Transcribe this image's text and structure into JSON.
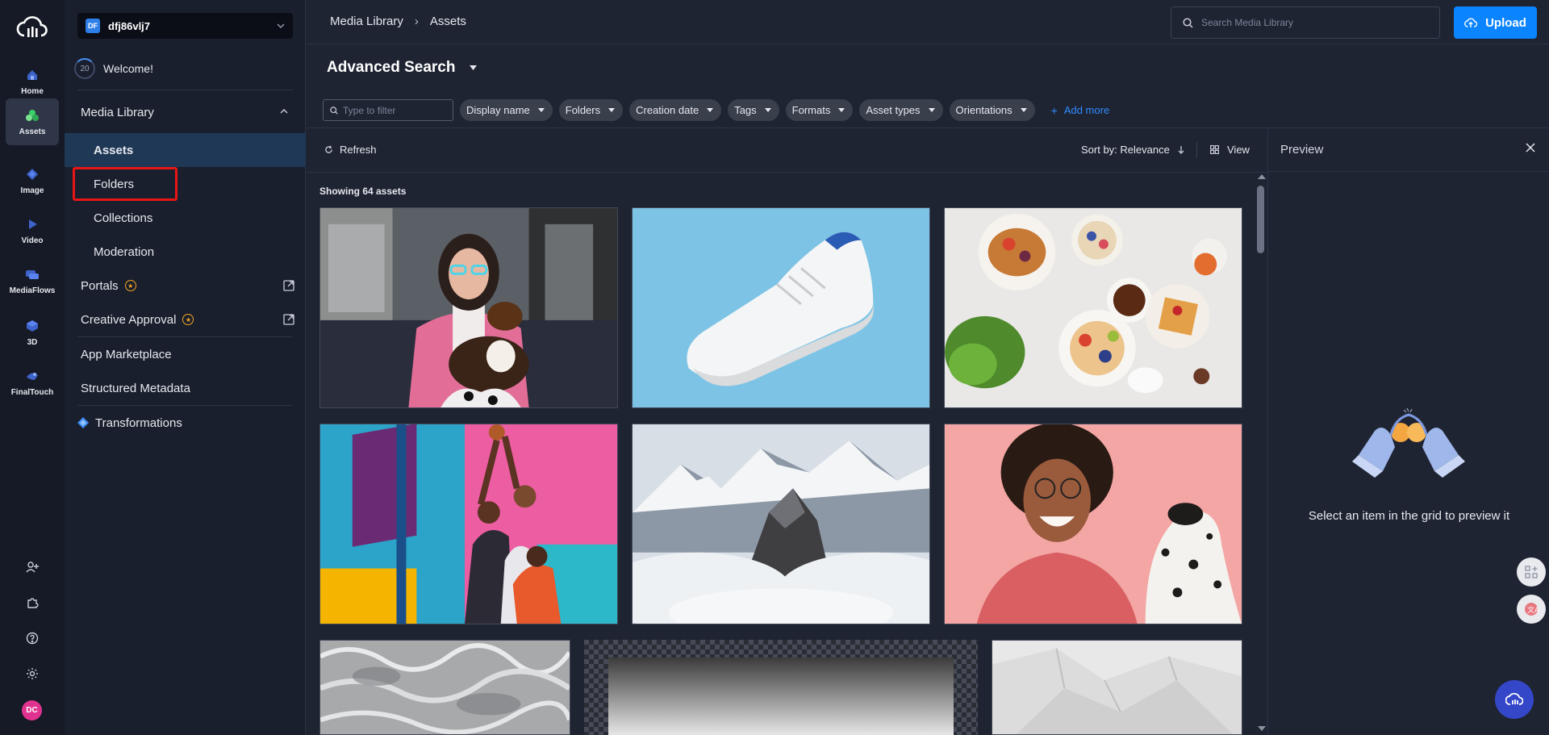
{
  "rail": {
    "items": [
      {
        "label": "Home",
        "icon": "home-icon"
      },
      {
        "label": "Assets",
        "icon": "assets-icon"
      },
      {
        "label": "Image",
        "icon": "image-icon"
      },
      {
        "label": "Video",
        "icon": "video-icon"
      },
      {
        "label": "MediaFlows",
        "icon": "mediaflows-icon"
      },
      {
        "label": "3D",
        "icon": "cube-icon"
      },
      {
        "label": "FinalTouch",
        "icon": "finaltouch-icon"
      }
    ],
    "active": "Assets",
    "avatar_initials": "DC"
  },
  "nav": {
    "cloud_badge": "DF",
    "cloud_name": "dfj86vlj7",
    "welcome_count": "20",
    "welcome_label": "Welcome!",
    "media_library": "Media Library",
    "sub_items": [
      "Assets",
      "Folders",
      "Collections",
      "Moderation"
    ],
    "selected_sub": "Assets",
    "portals": "Portals",
    "creative_approval": "Creative Approval",
    "app_marketplace": "App Marketplace",
    "structured_metadata": "Structured Metadata",
    "transformations": "Transformations"
  },
  "topbar": {
    "breadcrumb": [
      "Media Library",
      "Assets"
    ],
    "breadcrumb_sep": "›",
    "search_placeholder": "Search Media Library",
    "upload_label": "Upload"
  },
  "search_panel": {
    "title": "Advanced Search",
    "filter_placeholder": "Type to filter",
    "chips": [
      "Display name",
      "Folders",
      "Creation date",
      "Tags",
      "Formats",
      "Asset types",
      "Orientations"
    ],
    "add_more": "Add more"
  },
  "toolbar": {
    "refresh": "Refresh",
    "sort_by": "Sort by: Relevance",
    "view": "View"
  },
  "grid": {
    "showing": "Showing 64 assets"
  },
  "preview": {
    "title": "Preview",
    "message": "Select an item in the grid to preview it"
  },
  "colors": {
    "accent": "#0a84ff",
    "selected_nav": "#1f3855",
    "highlight": "#e81515"
  }
}
